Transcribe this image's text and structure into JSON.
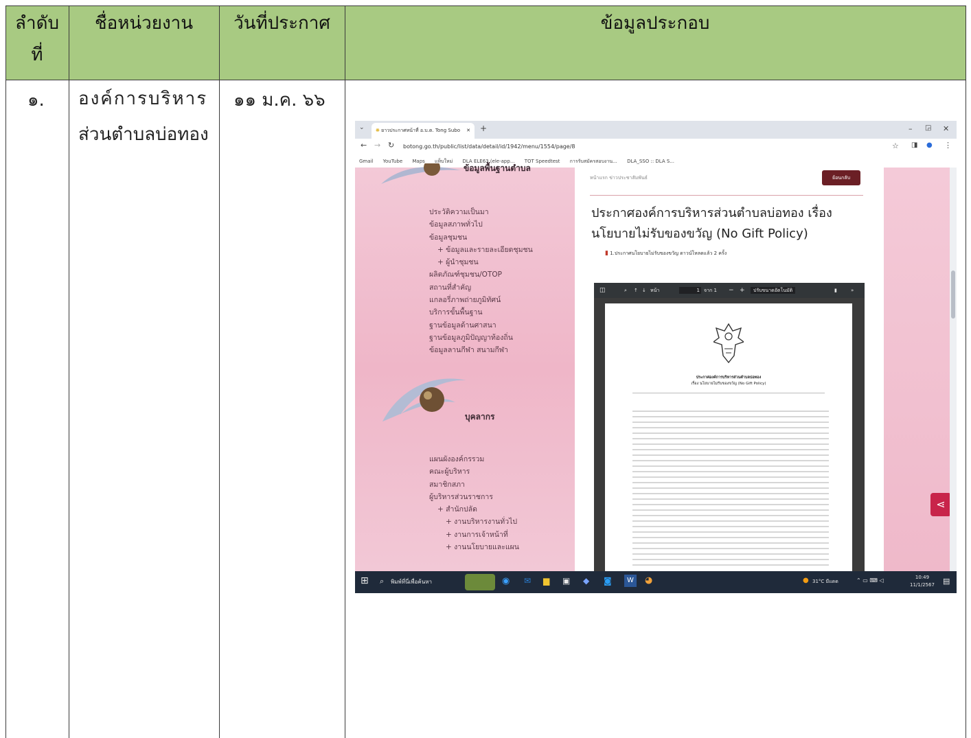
{
  "table": {
    "headers": [
      "ลำดับที่",
      "ชื่อหน่วยงาน",
      "วันที่ประกาศ",
      "ข้อมูลประกอบ"
    ],
    "header_line1": "ลำดับ",
    "header_line2": "ที่",
    "rows": [
      {
        "no": "๑.",
        "org_line1": "องค์การบริหาร",
        "org_line2": "ส่วนตำบลบ่อทอง",
        "date": "๑๑ ม.ค. ๖๖"
      }
    ]
  },
  "browser": {
    "tab_title": "ยาวประกาศหน้าที่ อ.บ.ต. Tong Subo",
    "url": "botong.go.th/public/list/data/detail/id/1942/menu/1554/page/8",
    "bookmarks": [
      "Gmail",
      "YouTube",
      "Maps",
      "แท็บใหม่",
      "DLA ELE63 (ele-app...",
      "TOT Speedtest",
      "การรับสมัครสอบงาน...",
      "DLA_SSO :: DLA S..."
    ]
  },
  "site": {
    "section1_title": "ข้อมูลพื้นฐานตำบล",
    "menu1": [
      "ประวัติความเป็นมา",
      "ข้อมูลสภาพทั่วไป",
      "ข้อมูลชุมชน",
      "+ ข้อมูลและรายละเอียดชุมชน",
      "+ ผู้นำชุมชน",
      "ผลิตภัณฑ์ชุมชน/OTOP",
      "สถานที่สำคัญ",
      "แกลอรี่ภาพถ่ายภูมิทัศน์",
      "บริการขั้นพื้นฐาน",
      "ฐานข้อมูลด้านศาสนา",
      "ฐานข้อมูลภูมิปัญญาท้องถิ่น",
      "ข้อมูลลานกีฬา สนามกีฬา"
    ],
    "section2_title": "บุคลากร",
    "menu2": [
      "แผนผังองค์กรรวม",
      "คณะผู้บริหาร",
      "สมาชิกสภา",
      "ผู้บริหารส่วนราชการ",
      "+ สำนักปลัด",
      "+ งานบริหารงานทั่วไป",
      "+ งานการเจ้าหน้าที่",
      "+ งานนโยบายและแผน"
    ],
    "breadcrumb": "หน้าแรก  ข่าวประชาสัมพันธ์",
    "back_button": "ย้อนกลับ",
    "article_title_line1": "ประกาศองค์การบริหารส่วนตำบลบ่อทอง เรื่อง",
    "article_title_line2": "นโยบายไม่รับของขวัญ (No Gift Policy)",
    "attachment": "1.ประกาศนโยบายไม่รับของขวัญ ดาวน์โหลดแล้ว 2 ครั้ง",
    "pdf_page_label": "หน้า",
    "pdf_page_num": "1",
    "pdf_page_of": "จาก 1",
    "pdf_zoom": "ปรับขนาดอัตโนมัติ",
    "doc_heading1": "ประกาศองค์การบริหารส่วนตำบลบ่อทอง",
    "doc_heading2": "เรื่อง นโยบายไม่รับของขวัญ (No Gift Policy)"
  },
  "taskbar": {
    "search_placeholder": "พิมพ์ที่นี่เพื่อค้นหา",
    "weather": "31°C มีแดด",
    "time": "10:49",
    "date": "11/1/2567"
  },
  "colors": {
    "header_green": "#a8ca82",
    "pink": "#f3c9d7",
    "taskbar": "#1f2a3a",
    "share_red": "#c8244a"
  }
}
